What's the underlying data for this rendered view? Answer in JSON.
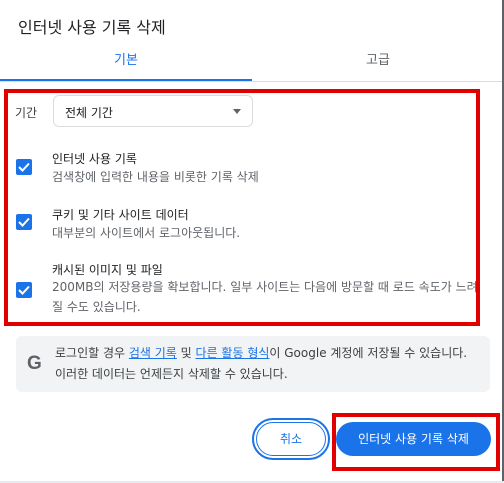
{
  "dialog": {
    "title": "인터넷 사용 기록 삭제"
  },
  "tabs": [
    {
      "label": "기본",
      "selected": true
    },
    {
      "label": "고급",
      "selected": false
    }
  ],
  "time_range": {
    "label": "기간",
    "value": "전체 기간"
  },
  "options": [
    {
      "title": "인터넷 사용 기록",
      "desc": "검색창에 입력한 내용을 비롯한 기록 삭제",
      "checked": true
    },
    {
      "title": "쿠키 및 기타 사이트 데이터",
      "desc": "대부분의 사이트에서 로그아웃됩니다.",
      "checked": true
    },
    {
      "title": "캐시된 이미지 및 파일",
      "desc": "200MB의 저장용량을 확보합니다. 일부 사이트는 다음에 방문할 때 로드 속도가 느려질 수도 있습니다.",
      "checked": true
    }
  ],
  "note": {
    "icon": "google-g-icon",
    "prefix": "로그인할 경우 ",
    "link1": "검색 기록",
    "mid": " 및 ",
    "link2": "다른 활동 형식",
    "suffix": "이 Google 계정에 저장될 수 있습니다. 이러한 데이터는 언제든지 삭제할 수 있습니다."
  },
  "buttons": {
    "cancel": "취소",
    "delete": "인터넷 사용 기록 삭제"
  },
  "colors": {
    "accent": "#1a73e8",
    "highlight": "#e00000"
  }
}
